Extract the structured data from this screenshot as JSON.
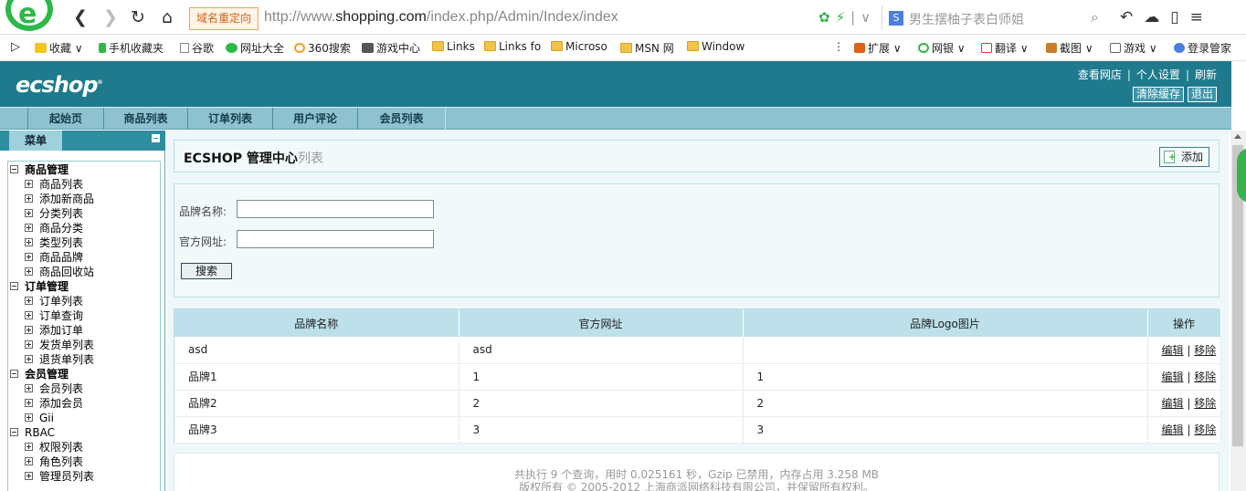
{
  "browser": {
    "redirect_label": "域名重定向",
    "url_host": "http://www.",
    "url_domain": "shopping.com",
    "url_path": "/index.php/Admin/Index/index",
    "search_placeholder": "男生摆柚子表白师姐",
    "search_engine_badge": "S"
  },
  "bookmarks": [
    {
      "label": "收藏",
      "icon": "star-icon"
    },
    {
      "label": "手机收藏夹",
      "icon": "phone-icon"
    },
    {
      "label": "谷歌",
      "icon": "page-icon"
    },
    {
      "label": "网址大全",
      "icon": "home-icon"
    },
    {
      "label": "360搜索",
      "icon": "search-icon"
    },
    {
      "label": "游戏中心",
      "icon": "gamepad-icon"
    },
    {
      "label": "Links",
      "icon": "folder-icon"
    },
    {
      "label": "Links fo",
      "icon": "folder-icon"
    },
    {
      "label": "Microso",
      "icon": "folder-icon"
    },
    {
      "label": "MSN 网",
      "icon": "folder-icon"
    },
    {
      "label": "Window",
      "icon": "folder-icon"
    },
    {
      "label": "扩展",
      "icon": "grid-icon"
    },
    {
      "label": "网银",
      "icon": "bank-icon"
    },
    {
      "label": "翻译",
      "icon": "translate-icon"
    },
    {
      "label": "截图",
      "icon": "scissors-icon"
    },
    {
      "label": "游戏",
      "icon": "game-icon"
    },
    {
      "label": "登录管家",
      "icon": "user-key-icon"
    }
  ],
  "header": {
    "logo": "ecshop",
    "links": [
      "查看网店",
      "个人设置",
      "刷新"
    ],
    "buttons": [
      "清除缓存",
      "退出"
    ]
  },
  "tabs": [
    "起始页",
    "商品列表",
    "订单列表",
    "用户评论",
    "会员列表"
  ],
  "sidebar": {
    "title": "菜单",
    "groups": [
      {
        "label": "商品管理",
        "items": [
          "商品列表",
          "添加新商品",
          "分类列表",
          "商品分类",
          "类型列表",
          "商品品牌",
          "商品回收站"
        ]
      },
      {
        "label": "订单管理",
        "items": [
          "订单列表",
          "订单查询",
          "添加订单",
          "发货单列表",
          "退货单列表"
        ]
      },
      {
        "label": "会员管理",
        "items": [
          "会员列表",
          "添加会员",
          "Gii"
        ]
      },
      {
        "label": "RBAC",
        "items": [
          "权限列表",
          "角色列表",
          "管理员列表"
        ]
      }
    ]
  },
  "main": {
    "title": "ECSHOP 管理中心",
    "title_sub": "列表",
    "add_label": "添加",
    "search": {
      "brand_label": "品牌名称:",
      "site_label": "官方网址:",
      "brand_value": "",
      "site_value": "",
      "submit_label": "搜索"
    },
    "table": {
      "columns": [
        "品牌名称",
        "官方网址",
        "品牌Logo图片",
        "操作"
      ],
      "rows": [
        [
          "asd",
          "asd",
          ""
        ],
        [
          "品牌1",
          "1",
          "1"
        ],
        [
          "品牌2",
          "2",
          "2"
        ],
        [
          "品牌3",
          "3",
          "3"
        ]
      ],
      "edit_label": "编辑",
      "sep": "|",
      "remove_label": "移除"
    },
    "footer_line1": "共执行 9 个查询，用时 0.025161 秒，Gzip 已禁用，内存占用 3.258 MB",
    "footer_line2": "版权所有 © 2005-2012 上海商派网络科技有限公司，并保留所有权利。"
  }
}
